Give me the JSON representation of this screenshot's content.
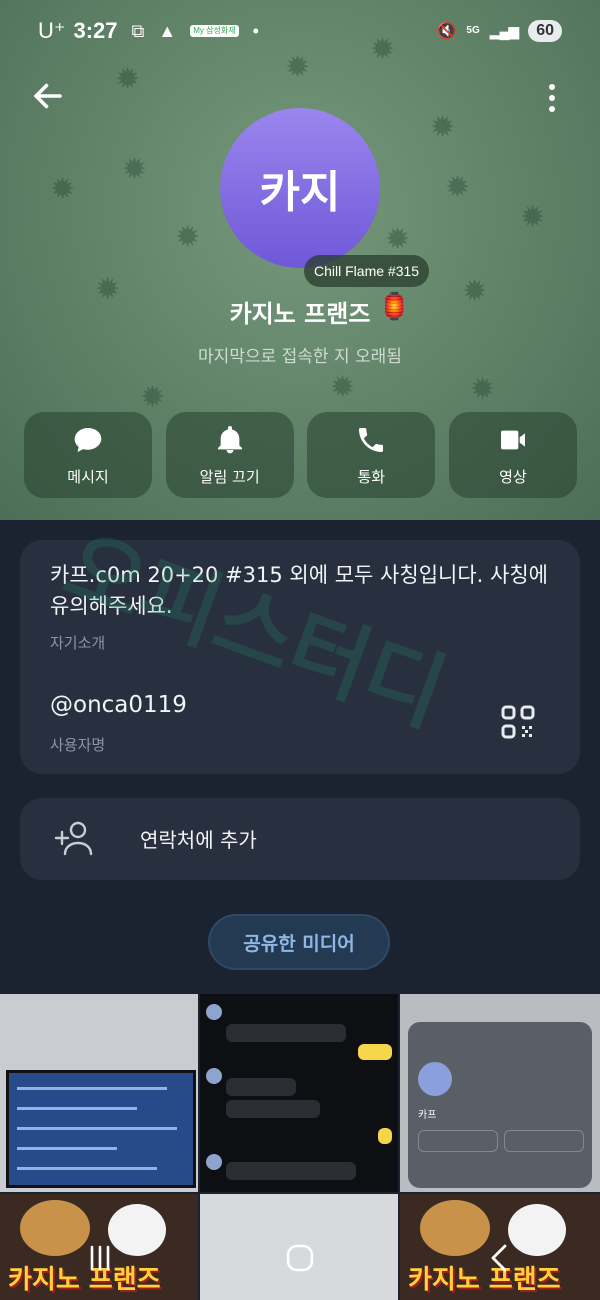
{
  "status_bar": {
    "carrier": "U⁺",
    "time": "3:27",
    "mini_app_badge": "My 삼성화재",
    "network": "5G",
    "battery": "60"
  },
  "profile": {
    "avatar_text": "카지",
    "badge": "Chill Flame #315",
    "name": "카지노 프랜즈",
    "last_seen": "마지막으로 접속한 지 오래됨"
  },
  "actions": [
    {
      "label": "메시지",
      "icon": "chat-bubble-icon"
    },
    {
      "label": "알림 끄기",
      "icon": "bell-icon"
    },
    {
      "label": "통화",
      "icon": "phone-icon"
    },
    {
      "label": "영상",
      "icon": "video-camera-icon"
    }
  ],
  "info": {
    "bio": "카프.c0m 20+20 #315 외에 모두 사칭입니다. 사칭에 유의해주세요.",
    "bio_label": "자기소개",
    "username": "@onca0119",
    "username_label": "사용자명"
  },
  "add_contact": {
    "label": "연락처에 추가"
  },
  "media": {
    "pill_label": "공유한 미디어",
    "thumb_contact_name": "카프",
    "banner_text": "카지노 프랜즈"
  },
  "watermark": "오피스터디"
}
